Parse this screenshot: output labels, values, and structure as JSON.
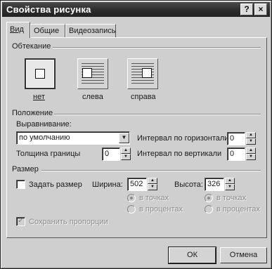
{
  "window": {
    "title": "Свойства рисунка",
    "help_button": "?",
    "close_button": "×"
  },
  "tabs": [
    {
      "label": "Вид"
    },
    {
      "label": "Общие"
    },
    {
      "label": "Видеозапись"
    }
  ],
  "wrapping": {
    "section_label": "Обтекание",
    "options": [
      {
        "label": "нет",
        "selected": true
      },
      {
        "label": "слева",
        "selected": false
      },
      {
        "label": "справа",
        "selected": false
      }
    ]
  },
  "position": {
    "section_label": "Положение",
    "alignment_label": "Выравнивание:",
    "alignment_value": "по умолчанию",
    "border_thickness_label": "Толщина границы",
    "border_thickness_value": "0",
    "horizontal_spacing_label": "Интервал по горизонтали",
    "horizontal_spacing_value": "0",
    "vertical_spacing_label": "Интервал по вертикали",
    "vertical_spacing_value": "0"
  },
  "size": {
    "section_label": "Размер",
    "specify_size_label": "Задать размер",
    "specify_size_checked": false,
    "width_label": "Ширина:",
    "width_value": "502",
    "height_label": "Высота:",
    "height_value": "326",
    "width_units": [
      {
        "label": "в точках",
        "checked": true
      },
      {
        "label": "в процентах",
        "checked": false
      }
    ],
    "height_units": [
      {
        "label": "в точках",
        "checked": true
      },
      {
        "label": "в процентах",
        "checked": false
      }
    ],
    "keep_aspect_label": "Сохранить пропорции",
    "keep_aspect_checked": true
  },
  "buttons": {
    "ok_label": "ОК",
    "cancel_label": "Отмена"
  }
}
